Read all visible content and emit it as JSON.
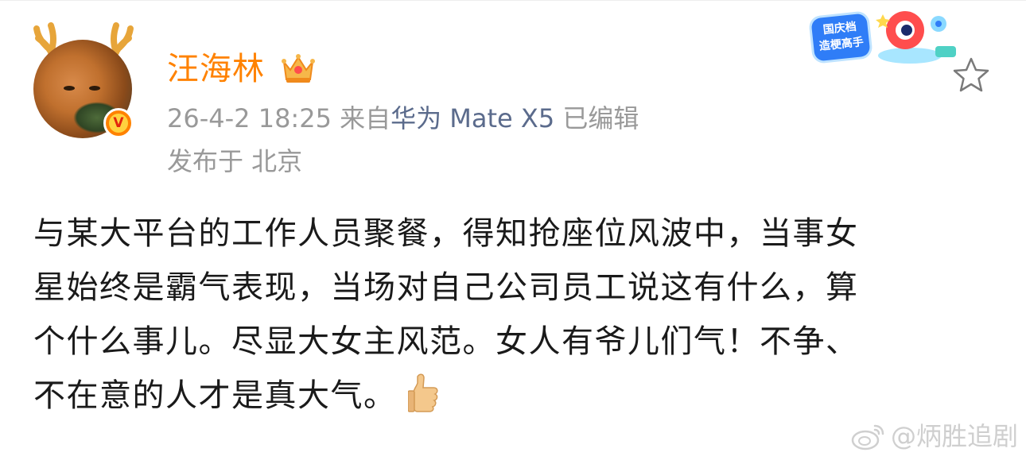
{
  "post": {
    "author": {
      "name": "汪海林",
      "avatar_icon": "cat-avatar-with-antlers",
      "verified_icon": "verified-v-icon",
      "badge_icon": "crown-icon"
    },
    "timestamp": "26-4-2 18:25",
    "source_prefix": "来自",
    "source_device": "华为 Mate X5",
    "edited": "已编辑",
    "location": "发布于 北京",
    "content_lines": [
      "与某大平台的工作人员聚餐，得知抢座位风波中，当事女",
      "星始终是霸气表现，当场对自己公司员工说这有什么，算",
      "个什么事儿。尽显大女主风范。女人有爷儿们气！不争、",
      "不在意的人才是真大气。"
    ],
    "emoji": "thumbs-up-emoji"
  },
  "promo": {
    "line1": "国庆档",
    "line2": "造梗高手"
  },
  "watermark": {
    "text": "@炳胜追剧",
    "icon": "weibo-logo-icon"
  },
  "colors": {
    "username": "#ff8200",
    "meta": "#999999",
    "source": "#5b6b8c",
    "content": "#1a1a1a",
    "watermark": "#cfcfcf"
  }
}
